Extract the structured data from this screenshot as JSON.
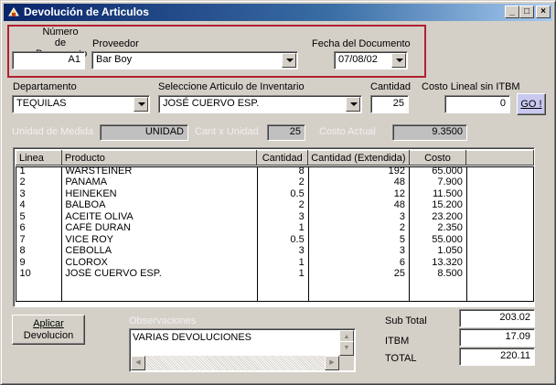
{
  "window": {
    "title": "Devolución de Articulos",
    "controls": {
      "minimize": "_",
      "maximize": "□",
      "close": "×"
    }
  },
  "header": {
    "numero_label": "Número de Documento",
    "numero_value": "A1",
    "proveedor_label": "Proveedor",
    "proveedor_value": "Bar Boy",
    "fecha_label": "Fecha del Documento",
    "fecha_value": "07/08/02"
  },
  "selection": {
    "departamento_label": "Departamento",
    "departamento_value": "TEQUILAS",
    "articulo_label": "Seleccione Articulo de Inventario",
    "articulo_value": "JOSÉ CUERVO ESP.",
    "cantidad_label": "Cantidad",
    "cantidad_value": "25",
    "costo_label": "Costo Lineal sin ITBM",
    "costo_value": "0",
    "go_label": "GO !"
  },
  "info": {
    "unidad_label": "Unidad de Medida",
    "unidad_value": "UNIDAD",
    "cantxunidad_label": "Cant x Unidad",
    "cantxunidad_value": "25",
    "costo_actual_label": "Costo Actual",
    "costo_actual_value": "9.3500"
  },
  "table": {
    "columns": [
      "Linea",
      "Producto",
      "Cantidad",
      "Cantidad (Extendida)",
      "Costo"
    ],
    "rows": [
      [
        "1",
        "WARSTEINER",
        "8",
        "192",
        "65.000"
      ],
      [
        "2",
        "PANAMA",
        "2",
        "48",
        "7.900"
      ],
      [
        "3",
        "HEINEKEN",
        "0.5",
        "12",
        "11.500"
      ],
      [
        "4",
        "BALBOA",
        "2",
        "48",
        "15.200"
      ],
      [
        "5",
        "ACEITE OLIVA",
        "3",
        "3",
        "23.200"
      ],
      [
        "6",
        "CAFÉ DURAN",
        "1",
        "2",
        "2.350"
      ],
      [
        "7",
        "VICE ROY",
        "0.5",
        "5",
        "55.000"
      ],
      [
        "8",
        "CEBOLLA",
        "3",
        "3",
        "1.050"
      ],
      [
        "9",
        "CLOROX",
        "1",
        "6",
        "13.320"
      ],
      [
        "10",
        "JOSÉ CUERVO ESP.",
        "1",
        "25",
        "8.500"
      ]
    ]
  },
  "footer": {
    "aplicar_line1": "Aplicar",
    "aplicar_line2": "Devolucion",
    "observaciones_label": "Observaciones",
    "observaciones_value": "VARIAS  DEVOLUCIONES",
    "subtotal_label": "Sub Total",
    "subtotal_value": "203.02",
    "itbm_label": "ITBM",
    "itbm_value": "17.09",
    "total_label": "TOTAL",
    "total_value": "220.11"
  },
  "colors": {
    "title_start": "#0a246a",
    "title_end": "#a6caf0",
    "highlight_border": "#b02030",
    "form_bg": "#d4d0c8",
    "go_button_bg": "#c8c8f0"
  }
}
